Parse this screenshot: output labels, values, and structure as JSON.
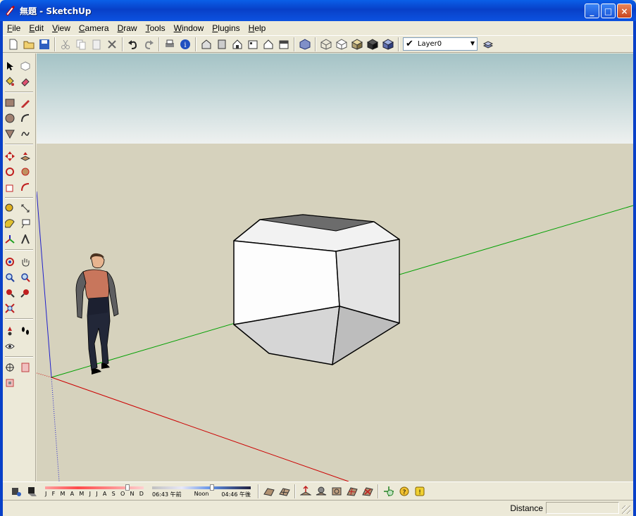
{
  "window": {
    "title": "無題 - SketchUp",
    "buttons": {
      "minimize": "_",
      "maximize": "□",
      "close": "×"
    }
  },
  "menu": [
    {
      "label": "File",
      "underline": "F",
      "rest": "ile"
    },
    {
      "label": "Edit",
      "underline": "E",
      "rest": "dit"
    },
    {
      "label": "View",
      "underline": "V",
      "rest": "iew"
    },
    {
      "label": "Camera",
      "underline": "C",
      "rest": "amera"
    },
    {
      "label": "Draw",
      "underline": "D",
      "rest": "raw"
    },
    {
      "label": "Tools",
      "underline": "T",
      "rest": "ools"
    },
    {
      "label": "Window",
      "underline": "W",
      "rest": "indow"
    },
    {
      "label": "Plugins",
      "underline": "P",
      "rest": "lugins"
    },
    {
      "label": "Help",
      "underline": "H",
      "rest": "elp"
    }
  ],
  "toolbar": {
    "layer": {
      "check": "✔",
      "value": "Layer0",
      "arrow": "▼"
    }
  },
  "shadows": {
    "months": [
      "J",
      "F",
      "M",
      "A",
      "M",
      "J",
      "J",
      "A",
      "S",
      "O",
      "N",
      "D"
    ],
    "time_start": "06:43 午前",
    "time_mid": "Noon",
    "time_end": "04:46 午後"
  },
  "status": {
    "measure_label": "Distance",
    "measure_value": ""
  },
  "colors": {
    "sky_top": "#a4c3c6",
    "sky_bottom": "#eef1f0",
    "ground": "#d6d2bd",
    "axis_red": "#cc0000",
    "axis_green": "#00a000",
    "axis_blue": "#2020cc"
  }
}
